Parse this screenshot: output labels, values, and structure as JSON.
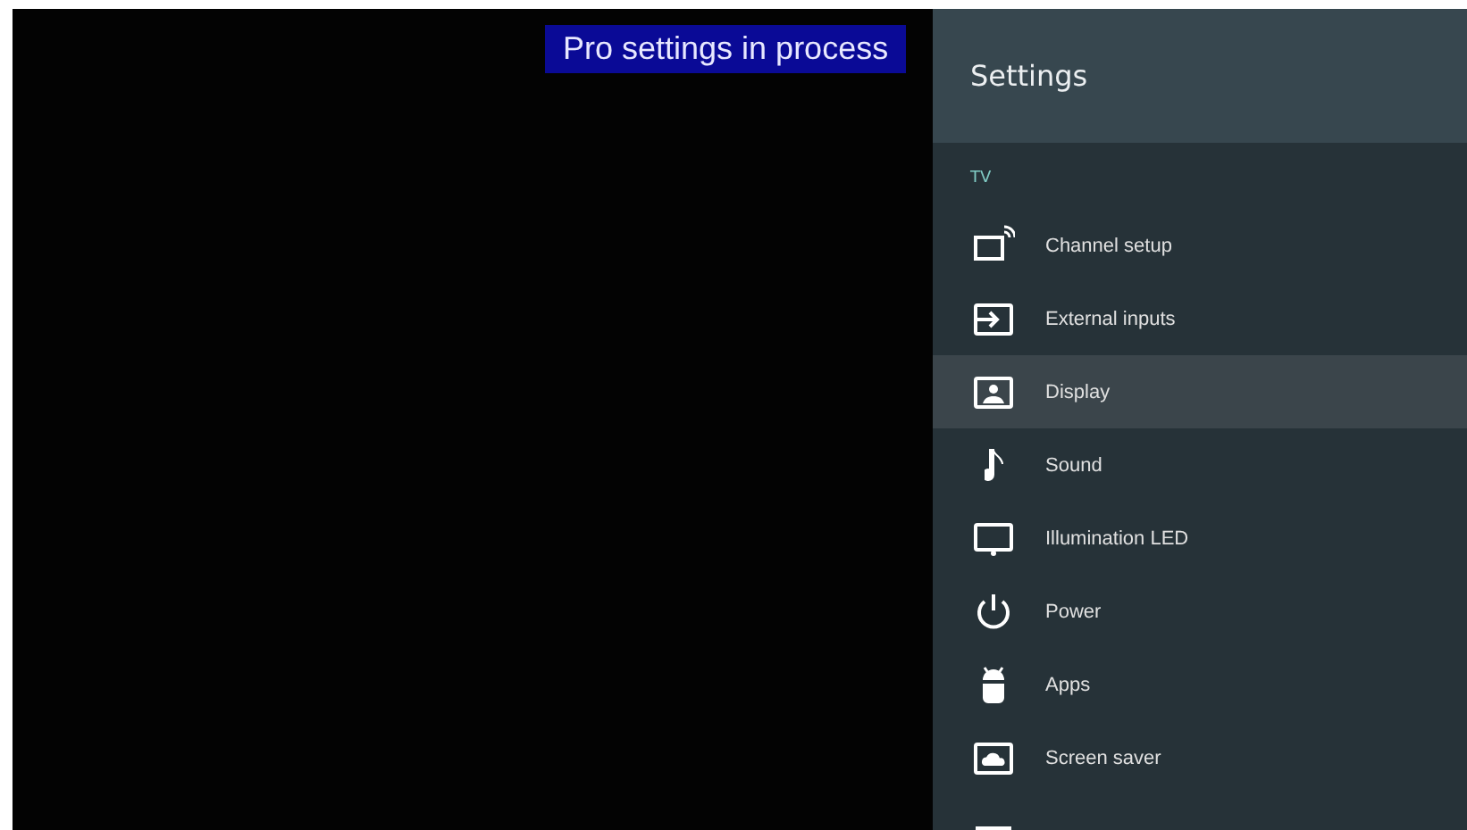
{
  "banner": {
    "text": "Pro settings in process"
  },
  "settings": {
    "title": "Settings",
    "section": "TV",
    "items": [
      {
        "kind": "channel",
        "label": "Channel setup",
        "selected": false
      },
      {
        "kind": "input",
        "label": "External inputs",
        "selected": false
      },
      {
        "kind": "display",
        "label": "Display",
        "selected": true
      },
      {
        "kind": "sound",
        "label": "Sound",
        "selected": false
      },
      {
        "kind": "led",
        "label": "Illumination LED",
        "selected": false
      },
      {
        "kind": "power",
        "label": "Power",
        "selected": false
      },
      {
        "kind": "apps",
        "label": "Apps",
        "selected": false
      },
      {
        "kind": "saver",
        "label": "Screen saver",
        "selected": false
      },
      {
        "kind": "storage",
        "selected": false
      }
    ]
  }
}
